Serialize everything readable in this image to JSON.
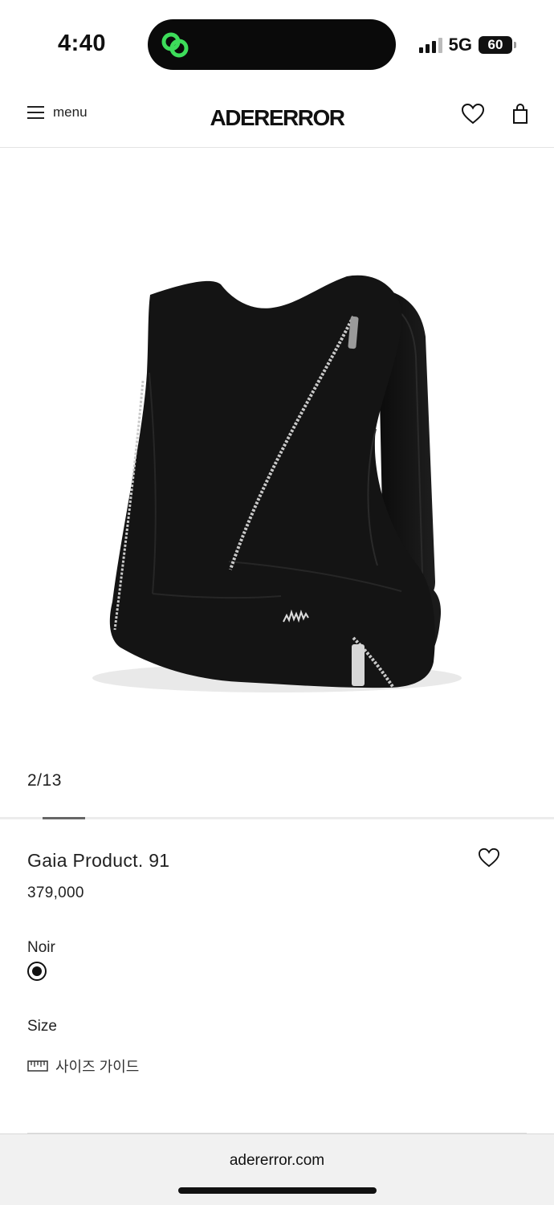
{
  "status_bar": {
    "time": "4:40",
    "network": "5G",
    "battery": "60"
  },
  "header": {
    "menu_label": "menu",
    "brand": "ADERERROR"
  },
  "gallery": {
    "counter": "2/13",
    "current_index": 2,
    "total": 13
  },
  "product": {
    "name": "Gaia Product. 91",
    "price": "379,000",
    "color_name": "Noir",
    "size_label": "Size",
    "size_guide_label": "사이즈 가이드"
  },
  "browser": {
    "url": "adererror.com"
  },
  "colors": {
    "accent_green": "#3ddc5a",
    "bag": "#141414"
  },
  "icons": {
    "menu": "hamburger-icon",
    "wishlist": "heart-icon",
    "cart": "shopping-bag-icon",
    "size_guide": "ruler-icon",
    "island_app": "link-rings-icon"
  }
}
